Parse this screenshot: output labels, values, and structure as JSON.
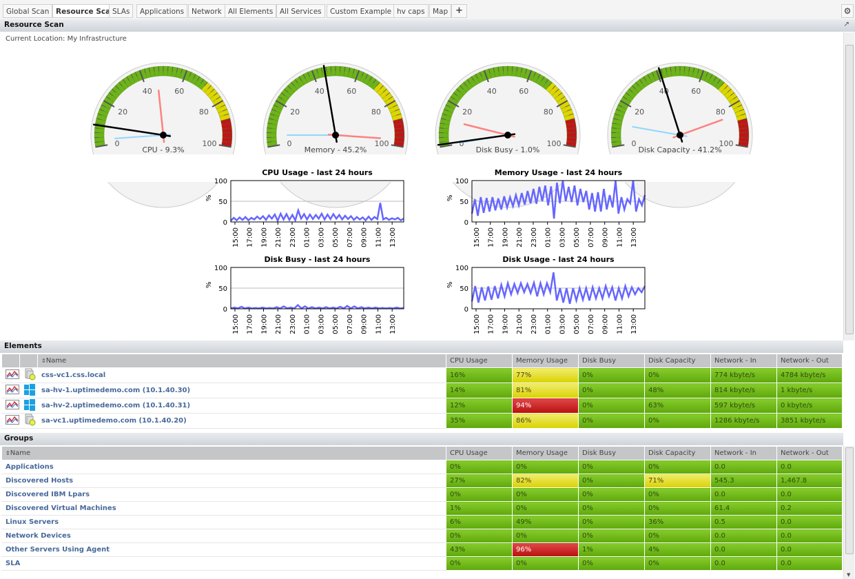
{
  "tabs": [
    "Global Scan",
    "Resource Scan",
    "SLAs",
    "Applications",
    "Network",
    "All Elements",
    "All Services",
    "Custom Example",
    "hv caps",
    "Map",
    "+"
  ],
  "active_tab": "Resource Scan",
  "panel_title": "Resource Scan",
  "location": "Current Location: My Infrastructure",
  "gauges": [
    {
      "label": "CPU - 9.3%",
      "value": 9.3,
      "max": 47,
      "min": 3
    },
    {
      "label": "Memory - 45.2%",
      "value": 45.2,
      "max": 97,
      "min": 5
    },
    {
      "label": "Disk Busy - 1.0%",
      "value": 1.0,
      "max": 12,
      "min": 0.5
    },
    {
      "label": "Disk Capacity - 41.2%",
      "value": 41.2,
      "max": 85,
      "min": 10
    }
  ],
  "gauge_ticks": [
    "0",
    "20",
    "40",
    "60",
    "80",
    "100"
  ],
  "charts": [
    {
      "title": "CPU Usage - last 24 hours",
      "ylabel": "%",
      "yticks": [
        "100",
        "50",
        "0"
      ],
      "values": [
        3,
        10,
        4,
        11,
        5,
        12,
        4,
        10,
        6,
        13,
        7,
        14,
        5,
        16,
        8,
        18,
        3,
        20,
        6,
        19,
        5,
        17,
        4,
        28,
        8,
        19,
        6,
        18,
        7,
        17,
        8,
        20,
        6,
        18,
        7,
        19,
        8,
        17,
        6,
        15,
        7,
        14,
        5,
        12,
        6,
        11,
        4,
        13,
        5,
        12,
        7,
        46,
        6,
        10,
        5,
        9,
        6,
        10,
        4,
        8
      ]
    },
    {
      "title": "Memory Usage - last 24 hours",
      "ylabel": "%",
      "yticks": [
        "100",
        "50",
        "0"
      ],
      "values": [
        20,
        55,
        15,
        60,
        22,
        58,
        25,
        60,
        28,
        57,
        30,
        62,
        35,
        60,
        38,
        65,
        40,
        70,
        42,
        75,
        45,
        80,
        44,
        85,
        50,
        88,
        40,
        86,
        8,
        95,
        45,
        100,
        50,
        85,
        48,
        88,
        40,
        80,
        48,
        75,
        30,
        70,
        25,
        72,
        25,
        80,
        30,
        65,
        35,
        100,
        20,
        60,
        30,
        55,
        45,
        100,
        25,
        55,
        40,
        65
      ]
    },
    {
      "title": "Disk Busy - last 24 hours",
      "ylabel": "%",
      "yticks": [
        "100",
        "50",
        "0"
      ],
      "values": [
        1,
        3,
        1,
        5,
        1,
        3,
        1,
        2,
        1,
        3,
        1,
        2,
        1,
        4,
        1,
        6,
        1,
        3,
        1,
        9,
        1,
        6,
        1,
        4,
        1,
        3,
        1,
        4,
        1,
        3,
        1,
        5,
        1,
        7,
        1,
        6,
        1,
        4,
        1,
        3,
        1,
        3,
        1,
        2,
        1,
        2,
        1,
        3,
        1,
        2
      ]
    },
    {
      "title": "Disk Usage - last 24 hours",
      "ylabel": "%",
      "yticks": [
        "100",
        "50",
        "0"
      ],
      "values": [
        18,
        55,
        15,
        52,
        20,
        54,
        22,
        55,
        25,
        58,
        30,
        62,
        35,
        60,
        38,
        62,
        40,
        60,
        38,
        63,
        30,
        62,
        35,
        62,
        40,
        88,
        20,
        50,
        15,
        50,
        12,
        50,
        20,
        50,
        22,
        50,
        20,
        52,
        25,
        50,
        25,
        55,
        30,
        52,
        20,
        50,
        25,
        55,
        30,
        52,
        35,
        50,
        40,
        55
      ]
    }
  ],
  "xticks": [
    "15:00",
    "17:00",
    "19:00",
    "21:00",
    "23:00",
    "01:00",
    "03:00",
    "05:00",
    "07:00",
    "09:00",
    "11:00",
    "13:00"
  ],
  "colors": {
    "green": "#6db31a",
    "yellow": "#ddd600",
    "red": "#c01515",
    "series": "#6666ff"
  },
  "elements": {
    "title": "Elements",
    "columns": [
      "Name",
      "CPU Usage",
      "Memory Usage",
      "Disk Busy",
      "Disk Capacity",
      "Network - In",
      "Network - Out"
    ],
    "rows": [
      {
        "name": "css-vc1.css.local",
        "os": "vmware",
        "cells": [
          "16%",
          "77%",
          "0%",
          "0%",
          "774 kbyte/s",
          "4784 kbyte/s"
        ],
        "status": [
          "g",
          "y",
          "g",
          "g",
          "g",
          "g"
        ]
      },
      {
        "name": "sa-hv-1.uptimedemo.com (10.1.40.30)",
        "os": "windows",
        "cells": [
          "14%",
          "81%",
          "0%",
          "48%",
          "814 kbyte/s",
          "1 kbyte/s"
        ],
        "status": [
          "g",
          "y",
          "g",
          "g",
          "g",
          "g"
        ]
      },
      {
        "name": "sa-hv-2.uptimedemo.com (10.1.40.31)",
        "os": "windows",
        "cells": [
          "12%",
          "94%",
          "0%",
          "63%",
          "597 kbyte/s",
          "0 kbyte/s"
        ],
        "status": [
          "g",
          "r",
          "g",
          "g",
          "g",
          "g"
        ]
      },
      {
        "name": "sa-vc1.uptimedemo.com (10.1.40.20)",
        "os": "vmware",
        "cells": [
          "35%",
          "86%",
          "0%",
          "0%",
          "1286 kbyte/s",
          "3851 kbyte/s"
        ],
        "status": [
          "g",
          "y",
          "g",
          "g",
          "g",
          "g"
        ]
      }
    ]
  },
  "groups": {
    "title": "Groups",
    "columns": [
      "Name",
      "CPU Usage",
      "Memory Usage",
      "Disk Busy",
      "Disk Capacity",
      "Network - In",
      "Network - Out"
    ],
    "rows": [
      {
        "name": "Applications",
        "cells": [
          "0%",
          "0%",
          "0%",
          "0%",
          "0.0",
          "0.0"
        ],
        "status": [
          "g",
          "g",
          "g",
          "g",
          "g",
          "g"
        ]
      },
      {
        "name": "Discovered Hosts",
        "cells": [
          "27%",
          "82%",
          "0%",
          "71%",
          "545.3",
          "1,467.8"
        ],
        "status": [
          "g",
          "y",
          "g",
          "y",
          "g",
          "g"
        ]
      },
      {
        "name": "Discovered IBM Lpars",
        "cells": [
          "0%",
          "0%",
          "0%",
          "0%",
          "0.0",
          "0.0"
        ],
        "status": [
          "g",
          "g",
          "g",
          "g",
          "g",
          "g"
        ]
      },
      {
        "name": "Discovered Virtual Machines",
        "cells": [
          "1%",
          "0%",
          "0%",
          "0%",
          "61.4",
          "0.2"
        ],
        "status": [
          "g",
          "g",
          "g",
          "g",
          "g",
          "g"
        ]
      },
      {
        "name": "Linux Servers",
        "cells": [
          "6%",
          "49%",
          "0%",
          "36%",
          "0.5",
          "0.0"
        ],
        "status": [
          "g",
          "g",
          "g",
          "g",
          "g",
          "g"
        ]
      },
      {
        "name": "Network Devices",
        "cells": [
          "0%",
          "0%",
          "0%",
          "0%",
          "0.0",
          "0.0"
        ],
        "status": [
          "g",
          "g",
          "g",
          "g",
          "g",
          "g"
        ]
      },
      {
        "name": "Other Servers Using Agent",
        "cells": [
          "43%",
          "96%",
          "1%",
          "4%",
          "0.0",
          "0.0"
        ],
        "status": [
          "g",
          "r",
          "g",
          "g",
          "g",
          "g"
        ]
      },
      {
        "name": "SLA",
        "cells": [
          "0%",
          "0%",
          "0%",
          "0%",
          "0.0",
          "0.0"
        ],
        "status": [
          "g",
          "g",
          "g",
          "g",
          "g",
          "g"
        ]
      }
    ]
  }
}
